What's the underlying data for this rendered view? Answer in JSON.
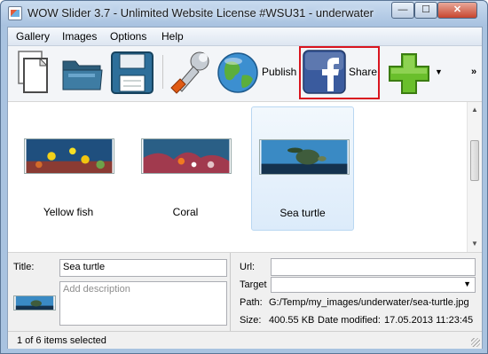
{
  "window": {
    "title": "WOW Slider 3.7 - Unlimited Website License #WSU31 - underwater",
    "controls": {
      "minimize": "—",
      "maximize": "☐",
      "close": "✕"
    }
  },
  "menu": [
    "Gallery",
    "Images",
    "Options",
    "Help"
  ],
  "toolbar": {
    "items": [
      {
        "name": "new-icon"
      },
      {
        "name": "open-folder-icon"
      },
      {
        "name": "save-icon"
      },
      {
        "name": "wrench-icon"
      },
      {
        "name": "globe-icon",
        "label": "Publish"
      },
      {
        "name": "facebook-icon",
        "label": "Share"
      },
      {
        "name": "add-icon"
      }
    ],
    "dropdown_arrow": "▼",
    "more": "»",
    "highlight_color": "#d9151f"
  },
  "gallery": {
    "images": [
      {
        "label": "Yellow fish",
        "selected": false
      },
      {
        "label": "Coral",
        "selected": false
      },
      {
        "label": "Sea turtle",
        "selected": true
      }
    ],
    "scroll_up": "▲",
    "scroll_down": "▼"
  },
  "properties": {
    "title_label": "Title:",
    "title_value": "Sea turtle",
    "description_placeholder": "Add description",
    "url_label": "Url:",
    "url_value": "",
    "target_label": "Target",
    "target_value": "",
    "path_label": "Path:",
    "path_value": "G:/Temp/my_images/underwater/sea-turtle.jpg",
    "size_label": "Size:",
    "size_value": "400.55 KB",
    "date_label": "Date modified:",
    "date_value": "17.05.2013 11:23:45"
  },
  "status": {
    "text": "1 of 6 items selected"
  }
}
